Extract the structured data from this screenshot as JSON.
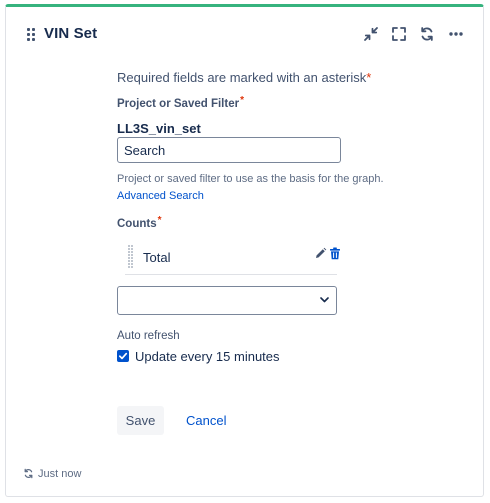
{
  "gadget": {
    "title": "VIN Set",
    "accent_color": "#36b37e",
    "header_icons": [
      "minimize-icon",
      "fullscreen-icon",
      "refresh-icon",
      "more-icon"
    ]
  },
  "form": {
    "required_note": "Required fields are marked with an asterisk",
    "asterisk": "*",
    "project_label": "Project or Saved Filter",
    "selected_filter": "LL3S_vin_set",
    "search_placeholder": "Search",
    "help_text": "Project or saved filter to use as the basis for the graph.",
    "advanced_search_link": "Advanced Search",
    "counts_label": "Counts",
    "counts_items": [
      {
        "label": "Total"
      }
    ],
    "select_value": "",
    "auto_refresh_label": "Auto refresh",
    "auto_refresh_checked": true,
    "auto_refresh_option": "Update every 15 minutes",
    "save_label": "Save",
    "cancel_label": "Cancel"
  },
  "footer": {
    "last_updated": "Just now"
  }
}
